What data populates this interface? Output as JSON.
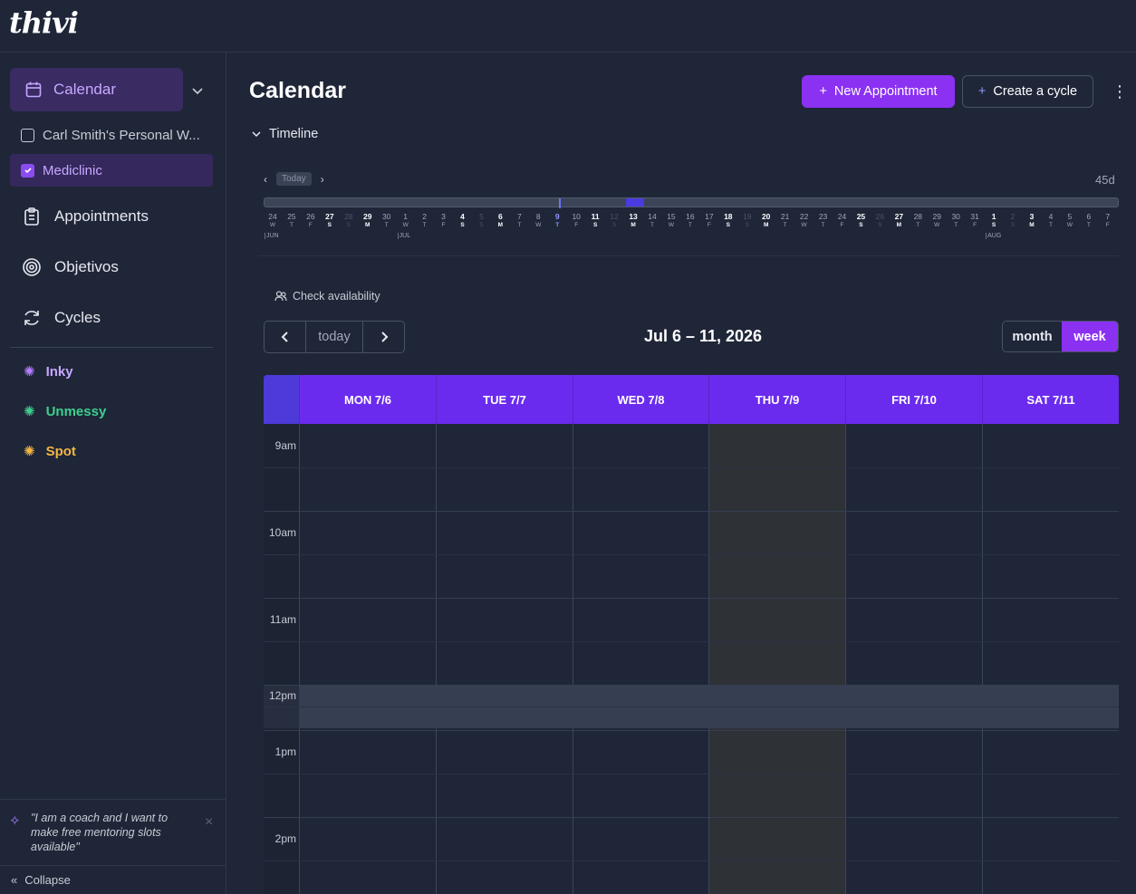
{
  "app": {
    "logo": "thivi"
  },
  "sidebar": {
    "calendar_label": "Calendar",
    "workspaces": [
      {
        "label": "Carl Smith's Personal W...",
        "checked": false
      },
      {
        "label": "Mediclinic",
        "checked": true
      }
    ],
    "nav": [
      {
        "label": "Appointments",
        "icon": "clipboard-icon"
      },
      {
        "label": "Objetivos",
        "icon": "target-icon"
      },
      {
        "label": "Cycles",
        "icon": "refresh-icon"
      }
    ],
    "apps": [
      {
        "label": "Inky",
        "color": "#b57cff"
      },
      {
        "label": "Unmessy",
        "color": "#3ecf8e"
      },
      {
        "label": "Spot",
        "color": "#f5b642"
      }
    ],
    "tip": "\"I am a coach and I want to make free mentoring slots available\"",
    "collapse_label": "Collapse"
  },
  "main": {
    "title": "Calendar",
    "new_appointment": "New Appointment",
    "create_cycle": "Create a cycle",
    "timeline_label": "Timeline",
    "timeline": {
      "today_label": "Today",
      "range_label": "45d",
      "days": [
        {
          "d": "24",
          "w": "W"
        },
        {
          "d": "25",
          "w": "T"
        },
        {
          "d": "26",
          "w": "F"
        },
        {
          "d": "27",
          "w": "S",
          "b": 1
        },
        {
          "d": "28",
          "w": "S",
          "dim": 1
        },
        {
          "d": "29",
          "w": "M",
          "b": 1
        },
        {
          "d": "30",
          "w": "T"
        },
        {
          "d": "1",
          "w": "W"
        },
        {
          "d": "2",
          "w": "T"
        },
        {
          "d": "3",
          "w": "F"
        },
        {
          "d": "4",
          "w": "S",
          "b": 1
        },
        {
          "d": "5",
          "w": "S",
          "dim": 1
        },
        {
          "d": "6",
          "w": "M",
          "b": 1
        },
        {
          "d": "7",
          "w": "T"
        },
        {
          "d": "8",
          "w": "W"
        },
        {
          "d": "9",
          "w": "T",
          "cur": 1
        },
        {
          "d": "10",
          "w": "F"
        },
        {
          "d": "11",
          "w": "S",
          "b": 1
        },
        {
          "d": "12",
          "w": "S",
          "dim": 1
        },
        {
          "d": "13",
          "w": "M",
          "b": 1
        },
        {
          "d": "14",
          "w": "T"
        },
        {
          "d": "15",
          "w": "W"
        },
        {
          "d": "16",
          "w": "T"
        },
        {
          "d": "17",
          "w": "F"
        },
        {
          "d": "18",
          "w": "S",
          "b": 1
        },
        {
          "d": "19",
          "w": "S",
          "dim": 1
        },
        {
          "d": "20",
          "w": "M",
          "b": 1
        },
        {
          "d": "21",
          "w": "T"
        },
        {
          "d": "22",
          "w": "W"
        },
        {
          "d": "23",
          "w": "T"
        },
        {
          "d": "24",
          "w": "F"
        },
        {
          "d": "25",
          "w": "S",
          "b": 1
        },
        {
          "d": "26",
          "w": "S",
          "dim": 1
        },
        {
          "d": "27",
          "w": "M",
          "b": 1
        },
        {
          "d": "28",
          "w": "T"
        },
        {
          "d": "29",
          "w": "W"
        },
        {
          "d": "30",
          "w": "T"
        },
        {
          "d": "31",
          "w": "F"
        },
        {
          "d": "1",
          "w": "S",
          "b": 1
        },
        {
          "d": "2",
          "w": "S",
          "dim": 1
        },
        {
          "d": "3",
          "w": "M",
          "b": 1
        },
        {
          "d": "4",
          "w": "T"
        },
        {
          "d": "5",
          "w": "W"
        },
        {
          "d": "6",
          "w": "T"
        },
        {
          "d": "7",
          "w": "F"
        }
      ],
      "months": [
        {
          "label": "JUN",
          "day_index": 0
        },
        {
          "label": "JUL",
          "day_index": 7
        },
        {
          "label": "AUG",
          "day_index": 38
        }
      ]
    },
    "check_availability": "Check availability",
    "today_button": "today",
    "range_title": "Jul 6 – 11, 2026",
    "view_month": "month",
    "view_week": "week",
    "days": [
      "MON 7/6",
      "TUE 7/7",
      "WED 7/8",
      "THU 7/9",
      "FRI 7/10",
      "SAT 7/11"
    ],
    "times": [
      "9am",
      "10am",
      "11am",
      "12pm",
      "1pm",
      "2pm"
    ]
  }
}
